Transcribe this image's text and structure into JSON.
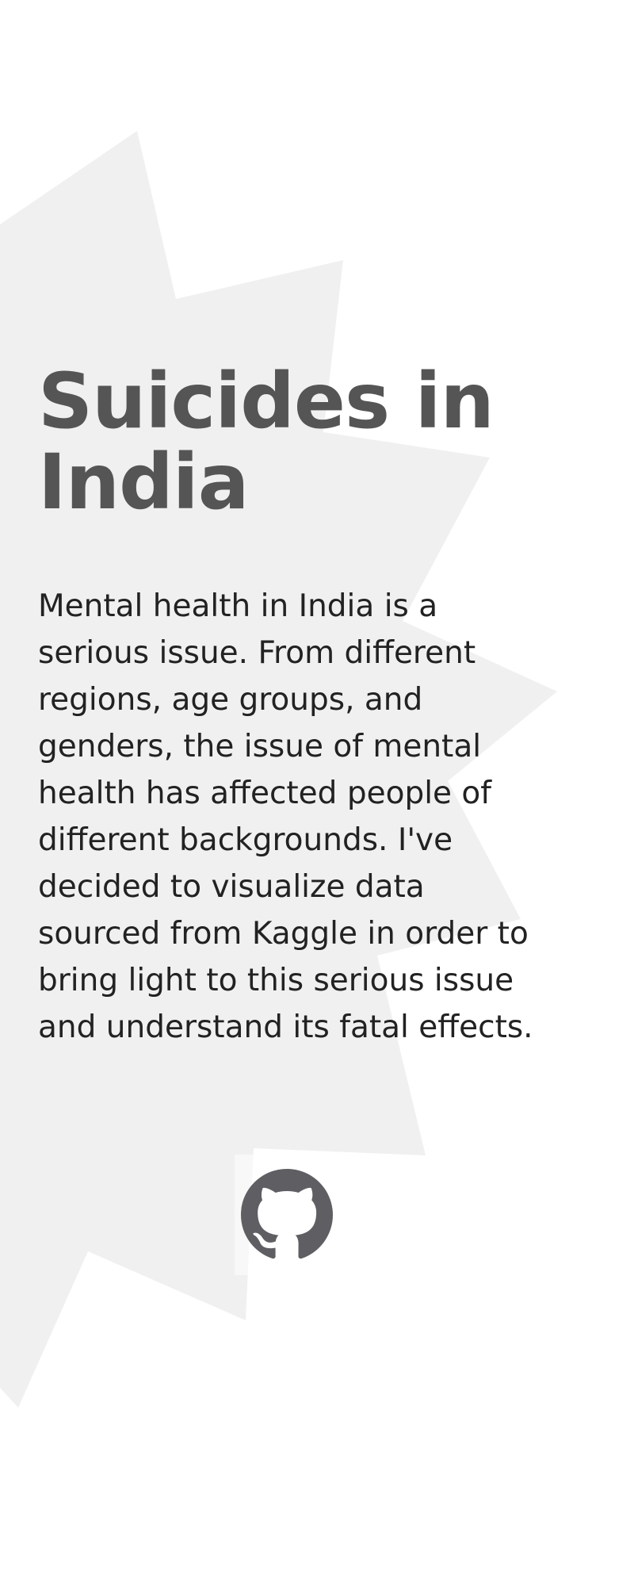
{
  "hero": {
    "title": "Suicides in India",
    "description": "Mental health in India is a serious issue. From different regions, age groups, and genders, the issue of mental health has affected people of different backgrounds. I've decided to visualize data sourced from Kaggle in order to bring light to this serious issue and understand its fatal effects."
  },
  "links": {
    "github_icon": "github-icon"
  },
  "colors": {
    "background": "#ffffff",
    "background_shape": "#f0f0f0",
    "title": "#555555",
    "body_text": "#222222",
    "icon": "#5f5f63"
  }
}
